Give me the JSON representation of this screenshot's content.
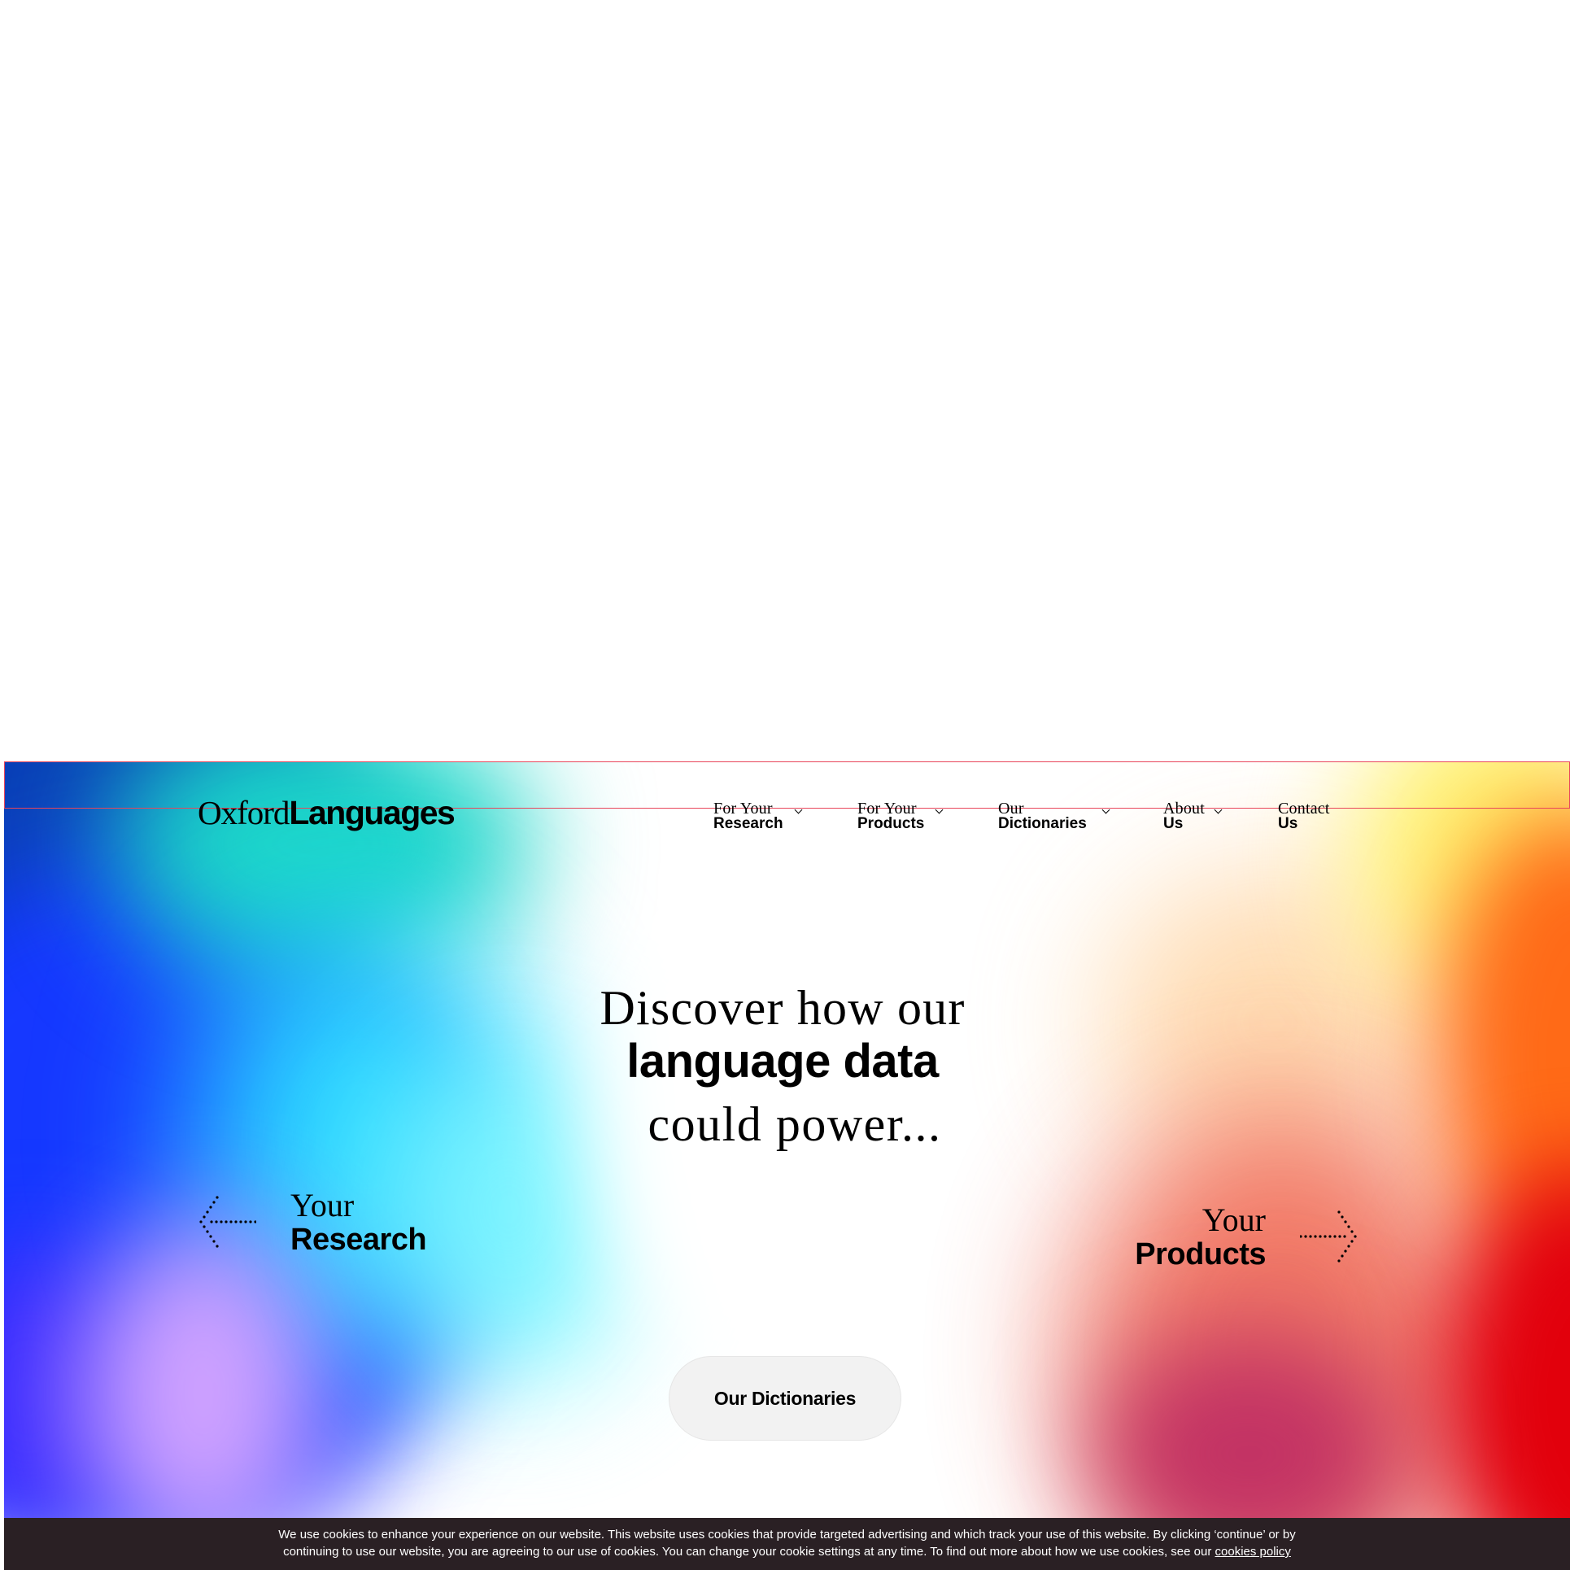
{
  "logo": {
    "serif": "Oxford",
    "sans": "Languages"
  },
  "nav": [
    {
      "top": "For Your",
      "bottom": "Research"
    },
    {
      "top": "For Your",
      "bottom": "Products"
    },
    {
      "top": "Our",
      "bottom": "Dictionaries"
    },
    {
      "top": "About",
      "bottom": "Us"
    },
    {
      "top": "Contact",
      "bottom": "Us"
    }
  ],
  "hero": {
    "line1": "Discover how our",
    "line2": "language data",
    "line3": "could power..."
  },
  "research_link": {
    "top": "Your",
    "bottom": "Research"
  },
  "products_link": {
    "top": "Your",
    "bottom": "Products"
  },
  "dictionaries_button": "Our Dictionaries",
  "cookie": {
    "line1": "We use cookies to enhance your experience on our website. This website uses cookies that provide targeted advertising and which track your use of this website. By clicking ‘continue’ or by",
    "line2": "continuing to use our website, you are agreeing to our use of cookies. You can change your cookie settings at any time. To find out more about how we use cookies, see our",
    "link": "cookies policy"
  },
  "colors": {
    "gradient_blue": "#1638ff",
    "gradient_cyan": "#2ad6ff",
    "gradient_teal": "#1cd6c9",
    "gradient_yellow": "#fff06a",
    "gradient_orange": "#ff6a17",
    "gradient_red": "#e2000c",
    "button_bg": "#f2f2f2",
    "cookie_bg": "#2a2024"
  },
  "icons": [
    "chevron-down-icon",
    "dotted-arrow-left-icon",
    "dotted-arrow-right-icon"
  ]
}
